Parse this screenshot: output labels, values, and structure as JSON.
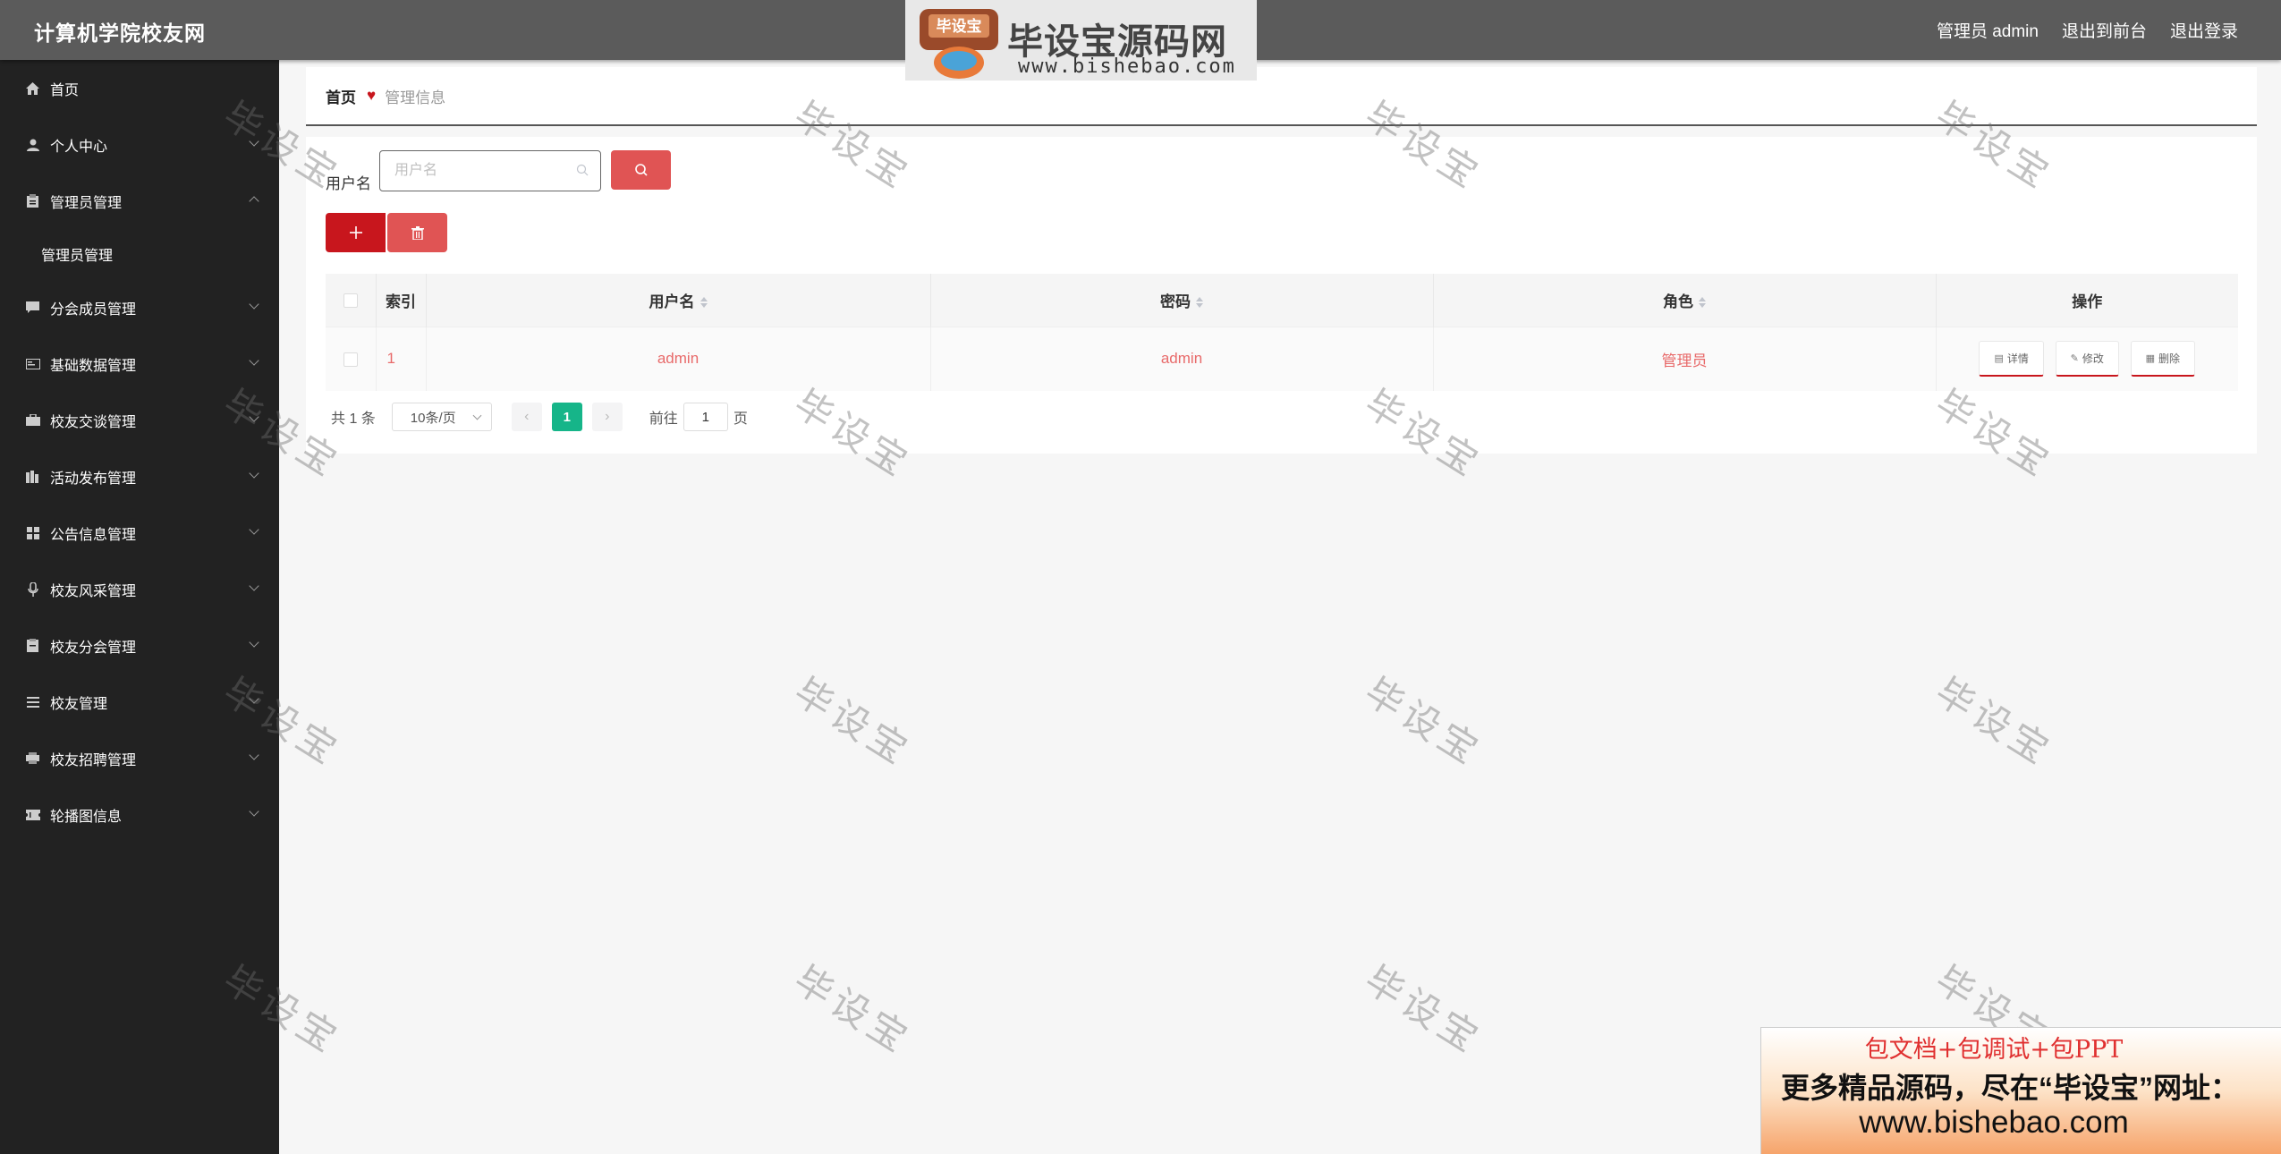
{
  "app": {
    "title": "计算机学院校友网"
  },
  "header": {
    "user_label": "管理员 admin",
    "front_label": "退出到前台",
    "logout_label": "退出登录"
  },
  "site_logo": {
    "name": "毕设宝源码网",
    "badge": "毕设宝",
    "url": "www.bishebao.com"
  },
  "sidebar": {
    "items": [
      {
        "label": "首页",
        "icon": "home-icon"
      },
      {
        "label": "个人中心",
        "icon": "user-icon"
      },
      {
        "label": "管理员管理",
        "icon": "clipboard-icon",
        "expanded": true,
        "sub": [
          "管理员管理"
        ]
      },
      {
        "label": "分会成员管理",
        "icon": "comment-icon"
      },
      {
        "label": "基础数据管理",
        "icon": "card-icon"
      },
      {
        "label": "校友交谈管理",
        "icon": "briefcase-icon"
      },
      {
        "label": "活动发布管理",
        "icon": "building-icon"
      },
      {
        "label": "公告信息管理",
        "icon": "grid-icon"
      },
      {
        "label": "校友风采管理",
        "icon": "microphone-icon"
      },
      {
        "label": "校友分会管理",
        "icon": "document-icon"
      },
      {
        "label": "校友管理",
        "icon": "list-icon"
      },
      {
        "label": "校友招聘管理",
        "icon": "printer-icon"
      },
      {
        "label": "轮播图信息",
        "icon": "ticket-icon"
      }
    ]
  },
  "breadcrumb": {
    "home": "首页",
    "current": "管理信息"
  },
  "search": {
    "label": "用户名",
    "placeholder": "用户名"
  },
  "table": {
    "headers": [
      "索引",
      "用户名",
      "密码",
      "角色",
      "操作"
    ],
    "rows": [
      {
        "index": "1",
        "username": "admin",
        "password": "admin",
        "role": "管理员"
      }
    ],
    "actions": {
      "detail": "详情",
      "edit": "修改",
      "delete": "删除"
    }
  },
  "pagination": {
    "total": "共 1 条",
    "page_size": "10条/页",
    "current_page": "1",
    "goto_prefix": "前往",
    "goto_value": "1",
    "goto_suffix": "页"
  },
  "watermark": "毕设宝",
  "ad": {
    "line1": "包文档+包调试+包PPT",
    "line2": "更多精品源码，尽在“毕设宝”网址：",
    "line3": "www.bishebao.com"
  },
  "colors": {
    "primary": "#c8161d",
    "secondary": "#e05454",
    "pager_active": "#16b589",
    "sidebar_bg": "#222222",
    "topbar_bg": "#5b5b5b"
  }
}
